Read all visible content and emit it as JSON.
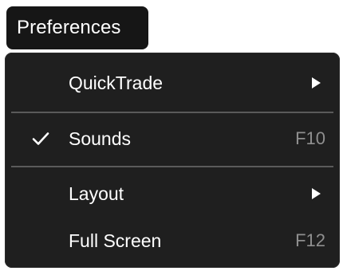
{
  "menu": {
    "title": "Preferences"
  },
  "items": [
    {
      "label": "QuickTrade",
      "checked": false,
      "submenu": true,
      "shortcut": "",
      "icon": "triangle-right-icon"
    },
    {
      "label": "Sounds",
      "checked": true,
      "submenu": false,
      "shortcut": "F10",
      "icon": "check-icon"
    },
    {
      "label": "Layout",
      "checked": false,
      "submenu": true,
      "shortcut": "",
      "icon": "triangle-right-icon"
    },
    {
      "label": "Full Screen",
      "checked": false,
      "submenu": false,
      "shortcut": "F12",
      "icon": ""
    }
  ],
  "colors": {
    "menu_background": "#1f1f1f",
    "title_background": "#161616",
    "text": "#ffffff",
    "shortcut_text": "#8f8f8f",
    "divider": "#5a5a5a"
  }
}
